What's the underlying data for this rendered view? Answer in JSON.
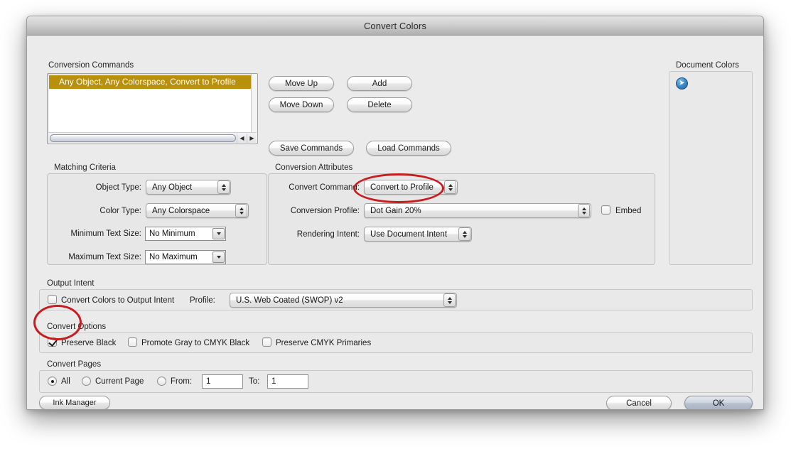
{
  "window": {
    "title": "Convert Colors"
  },
  "conversion_commands": {
    "group_label": "Conversion Commands",
    "list_items": [
      {
        "label": "Any Object, Any Colorspace, Convert to Profile",
        "selected": true
      }
    ],
    "scroll_left_icon": "scroll-left-arrow-icon",
    "scroll_right_icon": "scroll-right-arrow-icon",
    "buttons": {
      "move_up": "Move Up",
      "move_down": "Move Down",
      "add": "Add",
      "delete": "Delete",
      "save_commands": "Save Commands",
      "load_commands": "Load Commands"
    }
  },
  "document_colors": {
    "group_label": "Document Colors",
    "swatch_icon": "blue-right-arrow-circle-icon"
  },
  "matching_criteria": {
    "group_label": "Matching Criteria",
    "fields": [
      {
        "label": "Object Type:",
        "value": "Any Object",
        "kind": "popup"
      },
      {
        "label": "Color Type:",
        "value": "Any Colorspace",
        "kind": "popup"
      },
      {
        "label": "Minimum Text Size:",
        "value": "No Minimum",
        "kind": "combo"
      },
      {
        "label": "Maximum Text Size:",
        "value": "No Maximum",
        "kind": "combo"
      }
    ]
  },
  "conversion_attributes": {
    "group_label": "Conversion Attributes",
    "fields": [
      {
        "label": "Convert Command:",
        "value": "Convert to Profile"
      },
      {
        "label": "Conversion Profile:",
        "value": "Dot Gain 20%"
      },
      {
        "label": "Rendering Intent:",
        "value": "Use Document Intent"
      }
    ],
    "embed": {
      "label": "Embed",
      "checked": false
    }
  },
  "output_intent": {
    "group_label": "Output Intent",
    "checkbox": {
      "label": "Convert Colors to Output Intent",
      "checked": false
    },
    "profile_label": "Profile:",
    "profile_value": "U.S. Web Coated (SWOP) v2"
  },
  "convert_options": {
    "group_label": "Convert Options",
    "checkboxes": [
      {
        "label": "Preserve Black",
        "checked": true
      },
      {
        "label": "Promote Gray to CMYK Black",
        "checked": false
      },
      {
        "label": "Preserve CMYK Primaries",
        "checked": false
      }
    ]
  },
  "convert_pages": {
    "group_label": "Convert Pages",
    "radios": [
      {
        "label": "All",
        "checked": true
      },
      {
        "label": "Current Page",
        "checked": false
      },
      {
        "label": "From:",
        "checked": false
      }
    ],
    "from_value": "1",
    "to_label": "To:",
    "to_value": "1"
  },
  "footer": {
    "ink_manager": "Ink Manager",
    "cancel": "Cancel",
    "ok": "OK"
  },
  "annotations": {
    "color": "#c81d20",
    "marks": [
      {
        "name": "conversion-profile-highlight"
      },
      {
        "name": "preserve-black-highlight"
      }
    ]
  }
}
